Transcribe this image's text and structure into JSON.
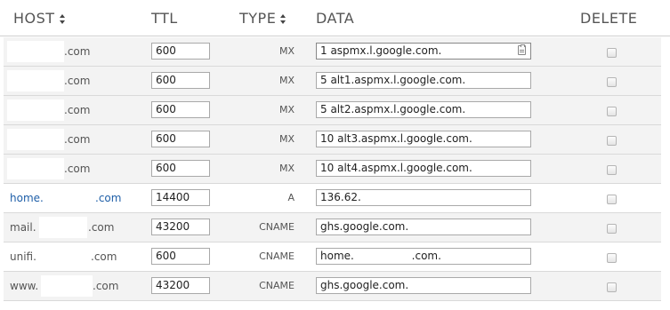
{
  "header": {
    "host": "HOST",
    "ttl": "TTL",
    "type": "TYPE",
    "data": "DATA",
    "delete": "DELETE"
  },
  "rows": [
    {
      "host_prefix": "",
      "host_suffix": ".com",
      "ttl": "600",
      "type": "MX",
      "data": "1 aspmx.l.google.com."
    },
    {
      "host_prefix": "",
      "host_suffix": ".com",
      "ttl": "600",
      "type": "MX",
      "data": "5 alt1.aspmx.l.google.com."
    },
    {
      "host_prefix": "",
      "host_suffix": ".com",
      "ttl": "600",
      "type": "MX",
      "data": "5 alt2.aspmx.l.google.com."
    },
    {
      "host_prefix": "",
      "host_suffix": ".com",
      "ttl": "600",
      "type": "MX",
      "data": "10 alt3.aspmx.l.google.com."
    },
    {
      "host_prefix": "",
      "host_suffix": ".com",
      "ttl": "600",
      "type": "MX",
      "data": "10 alt4.aspmx.l.google.com."
    },
    {
      "host_prefix": "home.",
      "host_suffix": ".com",
      "ttl": "14400",
      "type": "A",
      "data": "136.62."
    },
    {
      "host_prefix": "mail.",
      "host_suffix": ".com",
      "ttl": "43200",
      "type": "CNAME",
      "data": "ghs.google.com."
    },
    {
      "host_prefix": "unifi.",
      "host_suffix": ".com",
      "ttl": "600",
      "type": "CNAME",
      "data": "home.                 .com."
    },
    {
      "host_prefix": "www.",
      "host_suffix": ".com",
      "ttl": "43200",
      "type": "CNAME",
      "data": "ghs.google.com."
    }
  ],
  "colors": {
    "row_shaded": "#f3f3f3",
    "link": "#1f5fa8",
    "text": "#555555"
  },
  "icons": {
    "sort": "sort-arrows-icon",
    "clipboard": "clipboard-icon"
  }
}
